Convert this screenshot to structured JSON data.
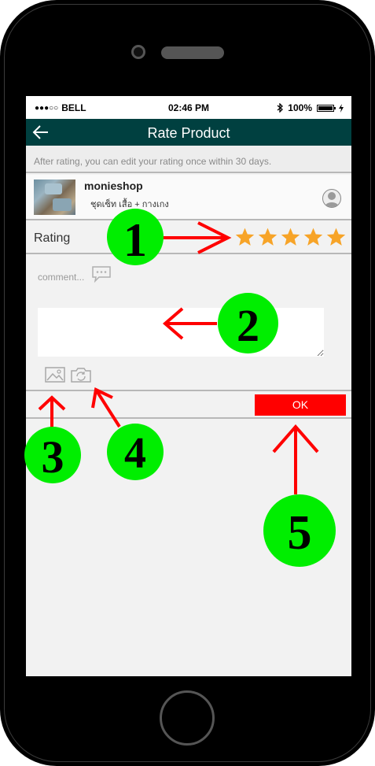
{
  "status_bar": {
    "carrier": "BELL",
    "time": "02:46 PM",
    "battery": "100%"
  },
  "nav": {
    "title": "Rate Product"
  },
  "notice": "After rating, you can edit your rating once within 30 days.",
  "product": {
    "shop_name": "monieshop",
    "product_name": "ชุดเซ็ท เสื้อ + กางเกง"
  },
  "rating": {
    "label": "Rating",
    "stars": 5,
    "max_stars": 5,
    "star_color": "#f7a428"
  },
  "comment": {
    "placeholder": "comment..."
  },
  "ok_button": {
    "label": "OK",
    "color": "#ff0000"
  },
  "callouts": [
    "1",
    "2",
    "3",
    "4",
    "5"
  ],
  "colors": {
    "nav_bar": "#004040",
    "callout_fill": "#00ee00",
    "arrow": "#ff0000"
  }
}
